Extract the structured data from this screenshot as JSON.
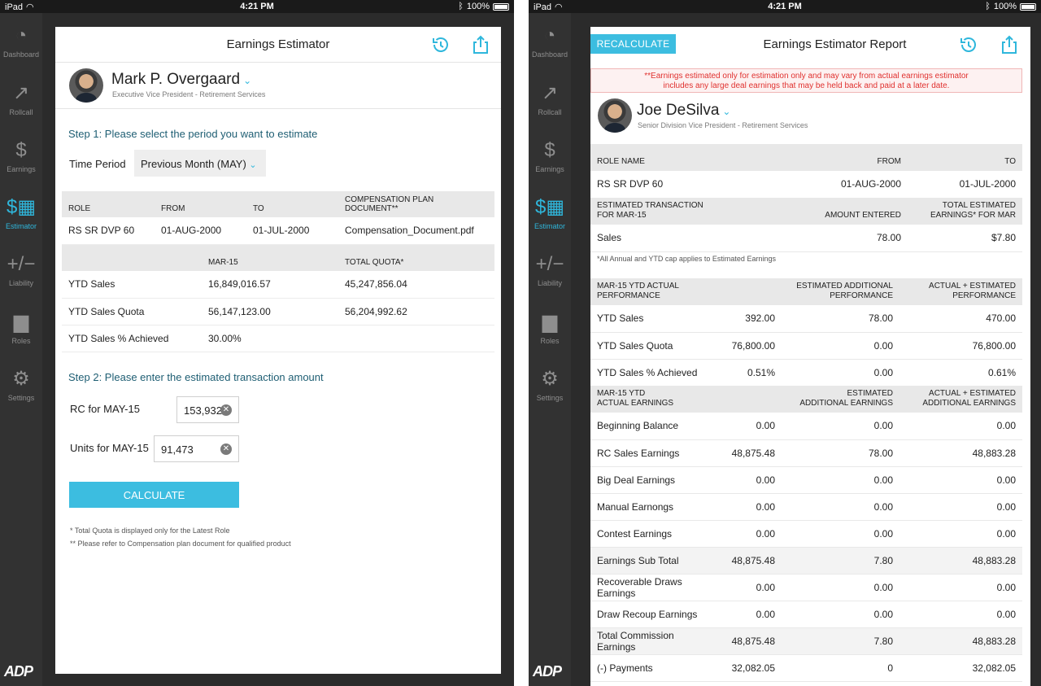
{
  "status_bar": {
    "device": "iPad",
    "time": "4:21 PM",
    "battery": "100%"
  },
  "sidebar": {
    "items": [
      {
        "label": "Dashboard",
        "icon": "speedometer-icon"
      },
      {
        "label": "Rollcall",
        "icon": "line-chart-icon"
      },
      {
        "label": "Earnings",
        "icon": "dollar-icon"
      },
      {
        "label": "Estimator",
        "icon": "calculator-icon",
        "active": true
      },
      {
        "label": "Liability",
        "icon": "plus-minus-icon"
      },
      {
        "label": "Roles",
        "icon": "top-hat-icon"
      },
      {
        "label": "Settings",
        "icon": "gear-icon"
      }
    ],
    "logo": "ADP"
  },
  "left": {
    "title": "Earnings Estimator",
    "person": {
      "name": "Mark P. Overgaard",
      "title": "Executive Vice President - Retirement Services"
    },
    "step1": "Step 1: Please select the period you want to estimate",
    "time_period_label": "Time Period",
    "time_period_value": "Previous Month (MAY)",
    "role_table": {
      "headers": [
        "ROLE",
        "FROM",
        "TO",
        "COMPENSATION PLAN DOCUMENT**"
      ],
      "row": [
        "RS SR DVP 60",
        "01-AUG-2000",
        "01-JUL-2000",
        "Compensation_Document.pdf"
      ]
    },
    "quota_table": {
      "headers": [
        "",
        "MAR-15",
        "TOTAL QUOTA*"
      ],
      "rows": [
        [
          "YTD Sales",
          "16,849,016.57",
          "45,247,856.04"
        ],
        [
          "YTD Sales Quota",
          "56,147,123.00",
          "56,204,992.62"
        ],
        [
          "YTD Sales % Achieved",
          "30.00%",
          ""
        ]
      ]
    },
    "step2": "Step 2: Please enter the estimated transaction amount",
    "rc_label": "RC for MAY-15",
    "rc_value": "153,932",
    "units_label": "Units for MAY-15",
    "units_value": "91,473",
    "calculate": "CALCULATE",
    "footnote1": "* Total Quota is displayed only for the Latest Role",
    "footnote2": "** Please refer to Compensation plan document for qualified product"
  },
  "right": {
    "title": "Earnings Estimator Report",
    "recalculate": "RECALCULATE",
    "warning_line1": "**Earnings estimated only for estimation only and may vary from actual earnings estimator",
    "warning_line2": "includes any large deal earnings that may be held back and paid at a later date.",
    "person": {
      "name": "Joe DeSilva",
      "title": "Senior Division Vice President - Retirement Services"
    },
    "role_table": {
      "headers": [
        "ROLE NAME",
        "FROM",
        "TO"
      ],
      "row": [
        "RS SR DVP 60",
        "01-AUG-2000",
        "01-JUL-2000"
      ]
    },
    "txn_table": {
      "headers": [
        "ESTIMATED TRANSACTION",
        "FOR MAR-15",
        "AMOUNT ENTERED",
        "TOTAL ESTIMATED",
        "EARNINGS* FOR MAR"
      ],
      "row": [
        "Sales",
        "78.00",
        "$7.80"
      ]
    },
    "cap_note": "*All Annual and YTD cap applies to Estimated Earnings",
    "perf_table": {
      "headers": [
        "MAR-15 YTD ACTUAL",
        "PERFORMANCE",
        "ESTIMATED ADDITIONAL",
        "PERFORMANCE",
        "ACTUAL + ESTIMATED",
        "PERFORMANCE"
      ],
      "rows": [
        [
          "YTD Sales",
          "392.00",
          "78.00",
          "470.00"
        ],
        [
          "YTD Sales Quota",
          "76,800.00",
          "0.00",
          "76,800.00"
        ],
        [
          "YTD Sales % Achieved",
          "0.51%",
          "0.00",
          "0.61%"
        ]
      ]
    },
    "earn_table": {
      "headers": [
        "MAR-15 YTD",
        "ACTUAL EARNINGS",
        "ESTIMATED",
        "ADDITIONAL EARNINGS",
        "ACTUAL + ESTIMATED",
        "ADDITIONAL EARNINGS"
      ],
      "rows": [
        [
          "Beginning Balance",
          "0.00",
          "0.00",
          "0.00"
        ],
        [
          "RC Sales Earnings",
          "48,875.48",
          "78.00",
          "48,883.28"
        ],
        [
          "Big Deal Earnings",
          "0.00",
          "0.00",
          "0.00"
        ],
        [
          "Manual Earnongs",
          "0.00",
          "0.00",
          "0.00"
        ],
        [
          "Contest Earnings",
          "0.00",
          "0.00",
          "0.00"
        ],
        [
          "Earnings Sub Total",
          "48,875.48",
          "7.80",
          "48,883.28"
        ],
        [
          "Recoverable Draws Earnings",
          "0.00",
          "0.00",
          "0.00"
        ],
        [
          "Draw Recoup Earnings",
          "0.00",
          "0.00",
          "0.00"
        ],
        [
          "Total Commission Earnings",
          "48,875.48",
          "7.80",
          "48,883.28"
        ],
        [
          "(-) Payments",
          "32,082.05",
          "0",
          "32,082.05"
        ]
      ]
    }
  }
}
